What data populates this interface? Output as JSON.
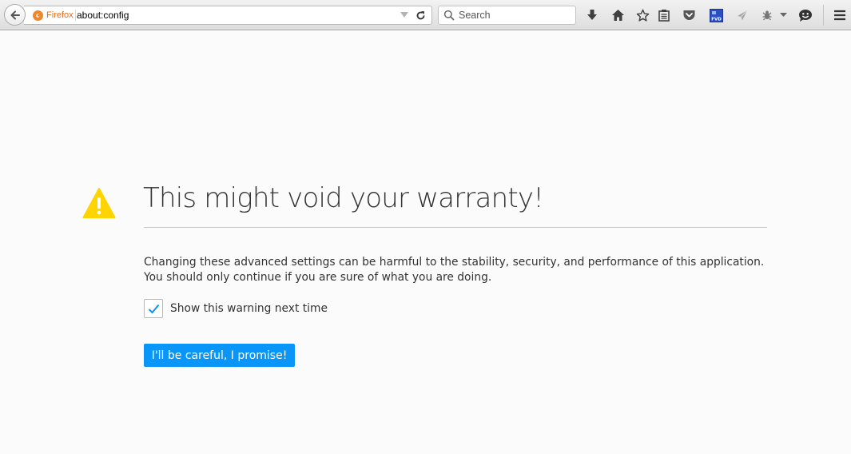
{
  "toolbar": {
    "identity_label": "Firefox",
    "url": "about:config",
    "search_placeholder": "Search",
    "icons": [
      "back-icon",
      "firefox-identity-icon",
      "history-dropdown-icon",
      "reload-icon",
      "search-icon",
      "downloads-icon",
      "home-icon",
      "bookmark-star-icon",
      "bookmarks-menu-icon",
      "pocket-icon",
      "fvd-extension-icon",
      "send-arrow-icon",
      "extension-bug-icon",
      "chevron-down-icon",
      "chat-icon",
      "hamburger-menu-icon"
    ]
  },
  "extensions": {
    "fvd_label": "FVD"
  },
  "warning": {
    "title": "This might void your warranty!",
    "description_line1": "Changing these advanced settings can be harmful to the stability, security, and performance of this application.",
    "description_line2": "You should only continue if you are sure of what you are doing.",
    "checkbox_label": "Show this warning next time",
    "checkbox_checked": true,
    "button_label": "I'll be careful, I promise!"
  },
  "colors": {
    "accent": "#0996f8",
    "warning": "#ffd400",
    "identity": "#e26b1a"
  }
}
